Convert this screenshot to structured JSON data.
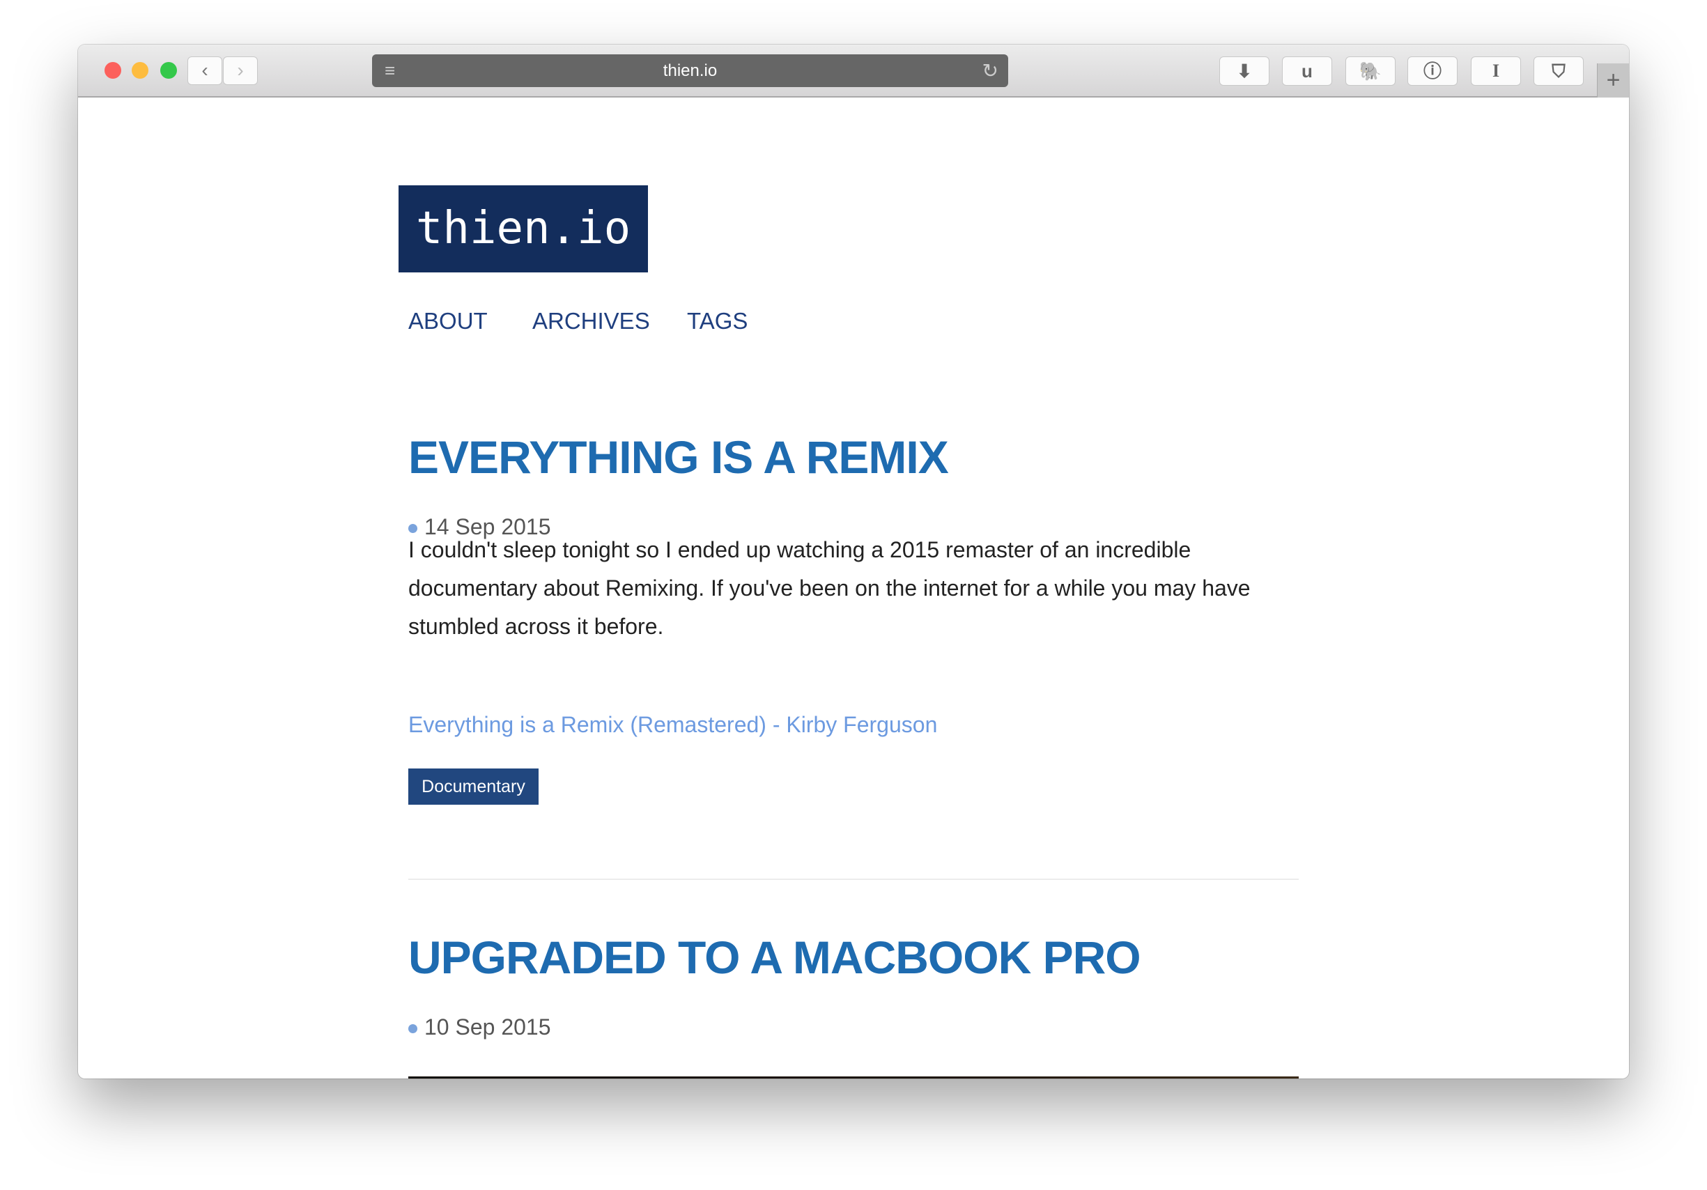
{
  "browser": {
    "url": "thien.io",
    "icons": [
      "close-dot",
      "minimize-dot",
      "zoom-dot",
      "back-icon",
      "forward-icon",
      "reader-icon",
      "reload-icon",
      "download-icon",
      "ublock-icon",
      "evernote-icon",
      "1password-icon",
      "instapaper-icon",
      "pocket-icon",
      "new-tab-icon"
    ],
    "ext_labels": {
      "ublock": "u",
      "instapaper": "I"
    },
    "colors": {
      "close": "#fc605c",
      "minimize": "#fdbc40",
      "zoom": "#34c84a"
    }
  },
  "site": {
    "logo": "thien.io",
    "nav": [
      "ABOUT",
      "ARCHIVES",
      "TAGS"
    ],
    "brand_color": "#132d5c"
  },
  "posts": [
    {
      "title": "EVERYTHING IS A REMIX",
      "date": "14 Sep 2015",
      "body": "I couldn't sleep tonight so I ended up watching a 2015 remaster of an incredible documentary about Remixing. If you've been on the internet for a while you may have stumbled across it before.",
      "link": "Everything is a Remix (Remastered) - Kirby Ferguson",
      "tag": "Documentary"
    },
    {
      "title": "UPGRADED TO A MACBOOK PRO",
      "date": "10 Sep 2015"
    }
  ]
}
